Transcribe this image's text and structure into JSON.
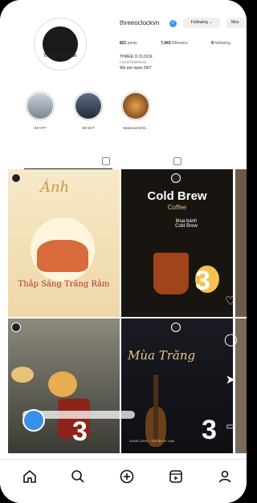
{
  "profile": {
    "brand_name": "THREE O'CLOCK",
    "username": "threeoclockvn",
    "following_label": "Following",
    "message_label": "Mes",
    "posts_count": "821",
    "posts_label": "posts",
    "followers_count": "7,443",
    "followers_label": "followers",
    "following_count": "8",
    "following_text": "following",
    "bio_name": "THREE O CLOCK",
    "bio_category": "Local business",
    "bio_hours": "We are open 24/7"
  },
  "highlights": [
    {
      "label": "04 HTT"
    },
    {
      "label": "06 NVT"
    },
    {
      "label": "Seasonal Drin..."
    }
  ],
  "posts": {
    "p1_script": "Ánh",
    "p1_title": "Thắp Sáng Trăng Rằm",
    "p2_title": "Cold Brew",
    "p2_sub": "Coffee",
    "p2_badge": "Mua bánh Cold Brew",
    "p3_title": "Mùa Trăng",
    "p3_date": "20h08-22h00 · Thứ Ba tới Tuần",
    "num": "3"
  },
  "side_icons": [
    "heart-icon",
    "comment-icon",
    "send-icon",
    "bookmark-icon"
  ],
  "nav": [
    "home-icon",
    "search-icon",
    "create-icon",
    "reels-icon",
    "profile-icon"
  ],
  "colors": {
    "verified": "#3897f0",
    "progress": "#3a8fea"
  }
}
